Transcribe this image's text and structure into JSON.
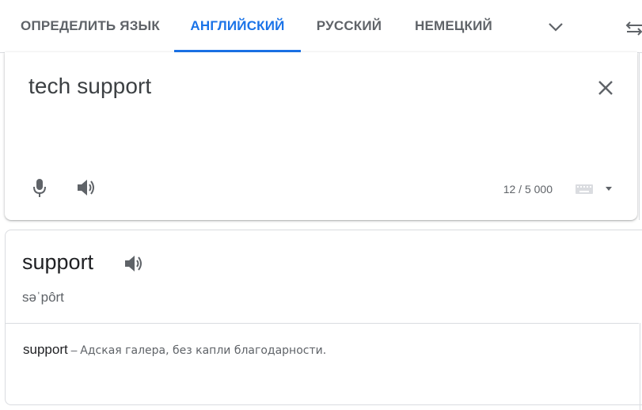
{
  "tabs": [
    {
      "label": "ОПРЕДЕЛИТЬ ЯЗЫК",
      "active": false
    },
    {
      "label": "АНГЛИЙСКИЙ",
      "active": true
    },
    {
      "label": "РУССКИЙ",
      "active": false
    },
    {
      "label": "НЕМЕЦКИЙ",
      "active": false
    }
  ],
  "accent_color": "#1a73e8",
  "source": {
    "text": "tech support",
    "char_count": "12 / 5 000",
    "icons": [
      "close-icon",
      "microphone-icon",
      "speaker-icon",
      "keyboard-icon",
      "dropdown-arrow-icon"
    ]
  },
  "dictionary": {
    "word": "support",
    "phonetic": "səˈpôrt",
    "definition_word": "support",
    "definition_dash": " – ",
    "definition_text": "Адская галера, без капли благодарности."
  }
}
